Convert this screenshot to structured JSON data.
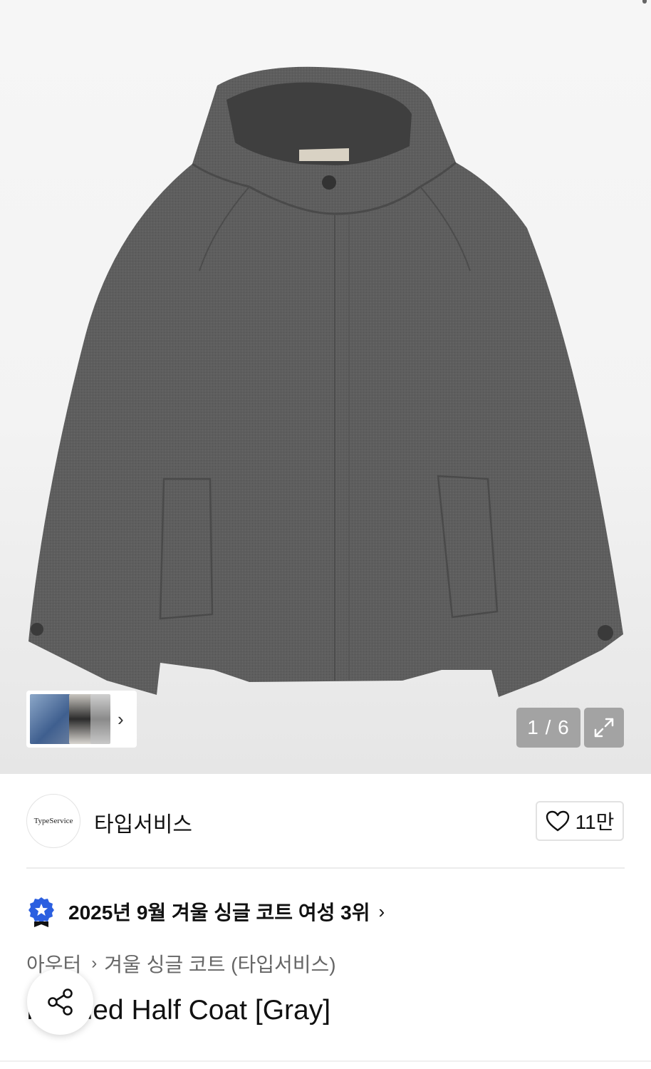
{
  "gallery": {
    "current": "1",
    "separator": "/",
    "total": "6",
    "counter_text": "1 / 6",
    "thumb_chevron": "›"
  },
  "brand": {
    "logo_text": "TypeService",
    "name": "타입서비스",
    "like_count": "11만"
  },
  "ranking": {
    "text": "2025년 9월 겨울 싱글 코트 여성 3위",
    "chevron": "›"
  },
  "breadcrumb": {
    "items": [
      "아우터",
      "겨울 싱글 코트 (타입서비스)"
    ],
    "separator": "›"
  },
  "product": {
    "title": "Hooded Half Coat [Gray]"
  },
  "icons": {
    "zoom": "expand-icon",
    "like": "heart-icon",
    "ranking": "rank-badge-icon",
    "share": "share-icon"
  },
  "colors": {
    "badge_blue": "#2b5fe0",
    "coat_gray": "#5f5f5f"
  }
}
